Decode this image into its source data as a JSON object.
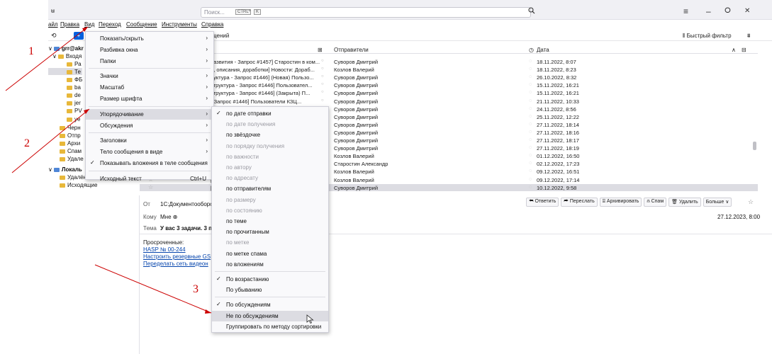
{
  "titlebar": {
    "app_icon": "ʉ",
    "search_placeholder": "Поиск...",
    "search_shortcut_ctrl": "CTRL",
    "search_shortcut_plus": "+",
    "search_shortcut_key": "K",
    "search_icon": "magnifier-icon",
    "window_controls": {
      "menu": "≡",
      "minimize": "–",
      "maximize": "ⵔ",
      "close": "✕"
    }
  },
  "menubar": [
    {
      "label": "айл"
    },
    {
      "label": "Правка"
    },
    {
      "label": "Вид"
    },
    {
      "label": "Переход"
    },
    {
      "label": "Сообщение"
    },
    {
      "label": "Инструменты"
    },
    {
      "label": "Справка"
    }
  ],
  "toolbar": {
    "new_message": "+",
    "messages_label": "общений",
    "quick_filter": "⫴ Быстрый фильтр",
    "quick_filter_icon": "⩩"
  },
  "folders": [
    {
      "label": "grr@akr",
      "bold": true,
      "prefix": "∨"
    },
    {
      "label": "Входя",
      "prefix": "∨"
    },
    {
      "label": "Ра"
    },
    {
      "label": "Те"
    },
    {
      "label": "ФБ"
    },
    {
      "label": "ba"
    },
    {
      "label": "de"
    },
    {
      "label": "jer"
    },
    {
      "label": "PV"
    },
    {
      "label": "ye"
    },
    {
      "label": "Черн"
    },
    {
      "label": "Отпр"
    },
    {
      "label": "Архи"
    },
    {
      "label": "Спам"
    },
    {
      "label": "Удале"
    },
    {
      "label": "Локаль",
      "bold": true,
      "prefix": "∨"
    },
    {
      "label": "Удалённые"
    },
    {
      "label": "Исходящие"
    }
  ],
  "list": {
    "col_senders": "Отправители",
    "col_date": "Дата",
    "rows": [
      {
        "subject": "развития - Запрос #1457] Старостин в ком...",
        "sender": "Суворов Дмитрий",
        "date": "18.11.2022, 8:07"
      },
      {
        "subject": "и, описания, доработки] Новости: Дораб...",
        "sender": "Козлов Валерий",
        "date": "18.11.2022, 8:23"
      },
      {
        "subject": "руктура - Запрос #1446] (Новая) Пользо...",
        "sender": "Суворов Дмитрий",
        "date": "26.10.2022, 8:32"
      },
      {
        "subject": "структура - Запрос #1446] Пользовател...",
        "sender": "Суворов Дмитрий",
        "date": "15.11.2022, 16:21"
      },
      {
        "subject": "структура - Запрос #1446] (Закрыта) П...",
        "sender": "Суворов Дмитрий",
        "date": "15.11.2022, 16:21"
      },
      {
        "subject": "- Запрос #1446] Пользователи КЗЦ...",
        "sender": "Суворов Дмитрий",
        "date": "21.11.2022, 10:33"
      },
      {
        "subject": "",
        "sender": "Суворов Дмитрий",
        "date": "24.11.2022, 8:56"
      },
      {
        "subject": "",
        "sender": "Суворов Дмитрий",
        "date": "25.11.2022, 12:22"
      },
      {
        "subject": "",
        "sender": "Суворов Дмитрий",
        "date": "27.11.2022, 18:14"
      },
      {
        "subject": "",
        "sender": "Суворов Дмитрий",
        "date": "27.11.2022, 18:16"
      },
      {
        "subject": "",
        "sender": "Суворов Дмитрий",
        "date": "27.11.2022, 18:17"
      },
      {
        "subject": "",
        "sender": "Суворов Дмитрий",
        "date": "27.11.2022, 18:19"
      },
      {
        "subject": "",
        "sender": "Козлов Валерий",
        "date": "01.12.2022, 16:50"
      },
      {
        "subject": "",
        "sender": "Старостин Александр",
        "date": "02.12.2022, 17:23"
      },
      {
        "subject": "",
        "sender": "Козлов Валерий",
        "date": "09.12.2022, 16:51"
      },
      {
        "subject": "[Инструкци",
        "sender": "Козлов Валерий",
        "date": "09.12.2022, 17:14"
      },
      {
        "subject": "[IT Инфраст",
        "sender": "Суворов Дмитрий",
        "date": "10.12.2022, 9:58",
        "selected": true
      }
    ]
  },
  "message": {
    "from_label": "От",
    "from_value": "1С:Документооборо",
    "to_label": "Кому",
    "to_value": "Мне ⊕",
    "subject_label": "Тема",
    "subject_value": "У вас 3 задачи. 3 пр",
    "date": "27.12.2023, 8:00",
    "actions": [
      "⮪ Ответить",
      "⮫ Переслать",
      "⌸ Архивировать",
      "⍝ Спам",
      "🗑 Удалить",
      "Больше ∨"
    ],
    "body_heading": "Просроченные:",
    "body_links": [
      "HASP № 00-244",
      "Настроить резервные GS",
      "Переделать сеть видеон"
    ]
  },
  "view_menu": [
    {
      "label": "Показать/скрыть",
      "arrow": true
    },
    {
      "label": "Разбивка окна",
      "arrow": true
    },
    {
      "label": "Папки",
      "arrow": true
    },
    {
      "label": "Значки",
      "arrow": true
    },
    {
      "label": "Масштаб",
      "arrow": true
    },
    {
      "label": "Размер шрифта",
      "arrow": true
    },
    {
      "label": "Упорядочивание",
      "arrow": true,
      "highlighted": true
    },
    {
      "label": "Обсуждения",
      "arrow": true
    },
    {
      "label": "Заголовки",
      "arrow": true
    },
    {
      "label": "Тело сообщения в виде",
      "arrow": true
    },
    {
      "label": "Показывать вложения в теле сообщения",
      "checked": true
    },
    {
      "label": "Исходный текст",
      "shortcut": "Ctrl+U"
    }
  ],
  "sort_menu": [
    {
      "label": "по дате отправки",
      "checked": true
    },
    {
      "label": "по дате получения",
      "disabled": true
    },
    {
      "label": "по звёздочке"
    },
    {
      "label": "по порядку получения",
      "disabled": true
    },
    {
      "label": "по важности",
      "disabled": true
    },
    {
      "label": "по автору",
      "disabled": true
    },
    {
      "label": "по адресату",
      "disabled": true
    },
    {
      "label": "по отправителям"
    },
    {
      "label": "по размеру",
      "disabled": true
    },
    {
      "label": "по состоянию",
      "disabled": true
    },
    {
      "label": "по теме"
    },
    {
      "label": "по прочитанным"
    },
    {
      "label": "по метке",
      "disabled": true
    },
    {
      "label": "по метке спама"
    },
    {
      "label": "по вложениям"
    },
    {
      "label": "По возрастанию",
      "checked": true
    },
    {
      "label": "По убыванию"
    },
    {
      "label": "По обсуждениям",
      "checked": true
    },
    {
      "label": "Не по обсуждениям",
      "highlighted": true
    },
    {
      "label": "Группировать по методу сортировки"
    }
  ],
  "annotations": [
    "1",
    "2",
    "3"
  ],
  "colors": {
    "annotation": "#cc0000",
    "accent": "#0060df",
    "highlight": "#dcdce2"
  }
}
